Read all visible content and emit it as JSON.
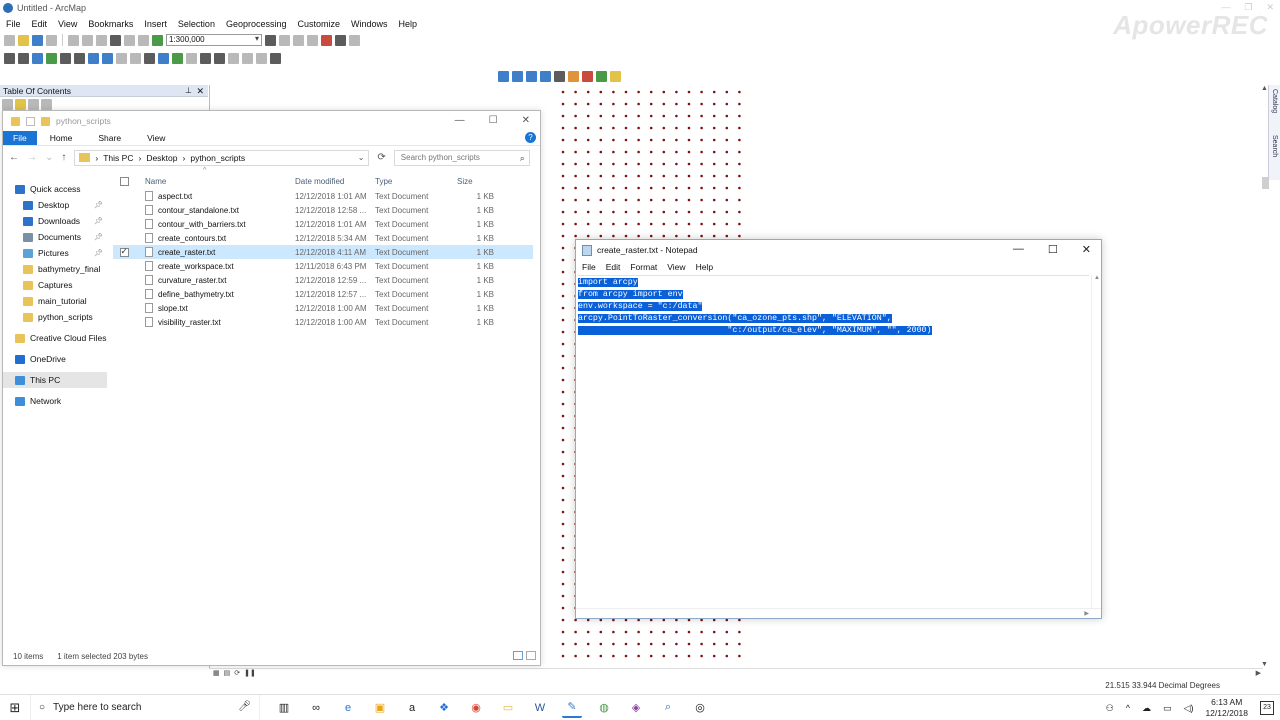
{
  "arcmap": {
    "title": "Untitled - ArcMap",
    "watermark": "ApowerREC",
    "menu": [
      "File",
      "Edit",
      "View",
      "Bookmarks",
      "Insert",
      "Selection",
      "Geoprocessing",
      "Customize",
      "Windows",
      "Help"
    ],
    "scale": "1:300,000",
    "toc_title": "Table Of Contents",
    "side_tabs": [
      "Catalog",
      "Search"
    ],
    "coordinates": "21.515  33.944 Decimal Degrees"
  },
  "explorer": {
    "title": "python_scripts",
    "ribbon_tabs": [
      "File",
      "Home",
      "Share",
      "View"
    ],
    "breadcrumb": [
      "This PC",
      "Desktop",
      "python_scripts"
    ],
    "search_placeholder": "Search python_scripts",
    "nav": [
      {
        "label": "Quick access",
        "icon": "star-icon",
        "color": "#2c73c9",
        "pinned": false,
        "indent": 0
      },
      {
        "label": "Desktop",
        "icon": "desktop-icon",
        "color": "#2c73c9",
        "pinned": true,
        "indent": 1
      },
      {
        "label": "Downloads",
        "icon": "download-icon",
        "color": "#2c73c9",
        "pinned": true,
        "indent": 1
      },
      {
        "label": "Documents",
        "icon": "documents-icon",
        "color": "#7b8fa6",
        "pinned": true,
        "indent": 1
      },
      {
        "label": "Pictures",
        "icon": "pictures-icon",
        "color": "#5aa2d8",
        "pinned": true,
        "indent": 1
      },
      {
        "label": "bathymetry_final",
        "icon": "folder-icon",
        "color": "#e8c45b",
        "pinned": false,
        "indent": 1
      },
      {
        "label": "Captures",
        "icon": "folder-icon",
        "color": "#e8c45b",
        "pinned": false,
        "indent": 1
      },
      {
        "label": "main_tutorial",
        "icon": "folder-icon",
        "color": "#e8c45b",
        "pinned": false,
        "indent": 1
      },
      {
        "label": "python_scripts",
        "icon": "folder-icon",
        "color": "#e8c45b",
        "pinned": false,
        "indent": 1
      },
      {
        "label": "Creative Cloud Files",
        "icon": "creative-cloud-icon",
        "color": "#e8c45b",
        "pinned": false,
        "indent": 0
      },
      {
        "label": "OneDrive",
        "icon": "onedrive-icon",
        "color": "#1e6fcf",
        "pinned": false,
        "indent": 0
      },
      {
        "label": "This PC",
        "icon": "this-pc-icon",
        "color": "#3f8fd8",
        "pinned": false,
        "indent": 0,
        "selected": true
      },
      {
        "label": "Network",
        "icon": "network-icon",
        "color": "#3f8fd8",
        "pinned": false,
        "indent": 0
      }
    ],
    "columns": {
      "name": "Name",
      "date": "Date modified",
      "type": "Type",
      "size": "Size"
    },
    "files": [
      {
        "name": "aspect.txt",
        "date": "12/12/2018 1:01 AM",
        "type": "Text Document",
        "size": "1 KB"
      },
      {
        "name": "contour_standalone.txt",
        "date": "12/12/2018 12:58 ...",
        "type": "Text Document",
        "size": "1 KB"
      },
      {
        "name": "contour_with_barriers.txt",
        "date": "12/12/2018 1:01 AM",
        "type": "Text Document",
        "size": "1 KB"
      },
      {
        "name": "create_contours.txt",
        "date": "12/12/2018 5:34 AM",
        "type": "Text Document",
        "size": "1 KB"
      },
      {
        "name": "create_raster.txt",
        "date": "12/12/2018 4:11 AM",
        "type": "Text Document",
        "size": "1 KB",
        "selected": true
      },
      {
        "name": "create_workspace.txt",
        "date": "12/11/2018 6:43 PM",
        "type": "Text Document",
        "size": "1 KB"
      },
      {
        "name": "curvature_raster.txt",
        "date": "12/12/2018 12:59 ...",
        "type": "Text Document",
        "size": "1 KB"
      },
      {
        "name": "define_bathymetry.txt",
        "date": "12/12/2018 12:57 ...",
        "type": "Text Document",
        "size": "1 KB"
      },
      {
        "name": "slope.txt",
        "date": "12/12/2018 1:00 AM",
        "type": "Text Document",
        "size": "1 KB"
      },
      {
        "name": "visibility_raster.txt",
        "date": "12/12/2018 1:00 AM",
        "type": "Text Document",
        "size": "1 KB"
      }
    ],
    "status_count": "10 items",
    "status_selection": "1 item selected  203 bytes"
  },
  "notepad": {
    "title": "create_raster.txt - Notepad",
    "menu": [
      "File",
      "Edit",
      "Format",
      "View",
      "Help"
    ],
    "code_lines": [
      "import arcpy",
      "from arcpy import env",
      "env.workspace = \"c:/data\"",
      "arcpy.PointToRaster_conversion(\"ca_ozone_pts.shp\", \"ELEVATION\",",
      "                              \"c:/output/ca_elev\", \"MAXIMUM\", \"\", 2000)"
    ]
  },
  "taskbar": {
    "search_placeholder": "Type here to search",
    "apps": [
      {
        "name": "task-view-icon",
        "glyph": "▥",
        "color": "#222222"
      },
      {
        "name": "cortana-icon",
        "glyph": "∞",
        "color": "#222222"
      },
      {
        "name": "edge-icon",
        "glyph": "e",
        "color": "#1e78d4"
      },
      {
        "name": "store-icon",
        "glyph": "▣",
        "color": "#e8a317"
      },
      {
        "name": "amazon-icon",
        "glyph": "a",
        "color": "#222222"
      },
      {
        "name": "dropbox-icon",
        "glyph": "❖",
        "color": "#1f6ed4"
      },
      {
        "name": "chrome-icon",
        "glyph": "◉",
        "color": "#d94535"
      },
      {
        "name": "file-explorer-icon",
        "glyph": "▭",
        "color": "#e8b84a"
      },
      {
        "name": "word-icon",
        "glyph": "W",
        "color": "#2b5797"
      },
      {
        "name": "notepad-icon",
        "glyph": "✎",
        "color": "#3c7fc4"
      },
      {
        "name": "arcgis-icon",
        "glyph": "◍",
        "color": "#4a9a48"
      },
      {
        "name": "arcmap-purple-icon",
        "glyph": "◈",
        "color": "#8a3fa8"
      },
      {
        "name": "arcmap-search-icon",
        "glyph": "⌕",
        "color": "#2c6fb7"
      },
      {
        "name": "recorder-icon",
        "glyph": "◎",
        "color": "#111111"
      }
    ],
    "time": "6:13 AM",
    "date": "12/12/2018",
    "notification_count": "23"
  }
}
